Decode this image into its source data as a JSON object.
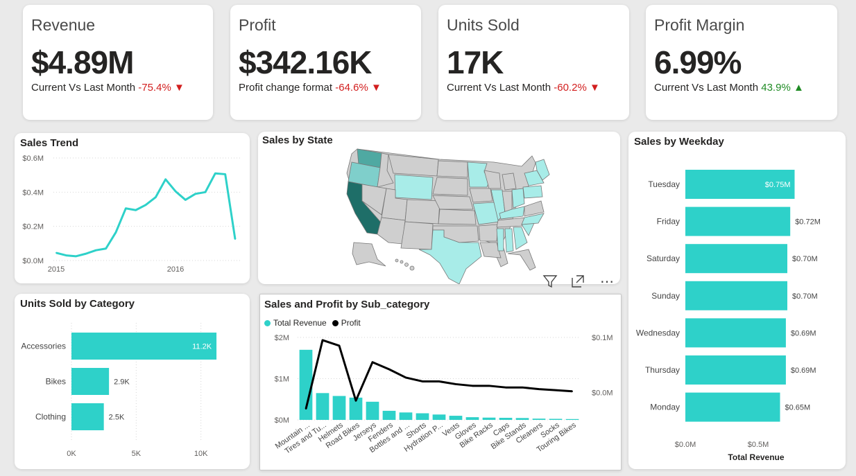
{
  "kpis": [
    {
      "title": "Revenue",
      "value": "$4.89M",
      "sub_label": "Current Vs Last Month",
      "change": "-75.4%",
      "direction": "down"
    },
    {
      "title": "Profit",
      "value": "$342.16K",
      "sub_label": "Profit change format",
      "change": "-64.6%",
      "direction": "down"
    },
    {
      "title": "Units Sold",
      "value": "17K",
      "sub_label": "Current Vs Last Month",
      "change": "-60.2%",
      "direction": "down"
    },
    {
      "title": "Profit Margin",
      "value": "6.99%",
      "sub_label": "Current Vs Last Month",
      "change": "43.9%",
      "direction": "up"
    }
  ],
  "arrows": {
    "down": "▼",
    "up": "▲"
  },
  "colors": {
    "teal": "#2ed1c9",
    "negative": "#d21e1e",
    "positive": "#1f8b24",
    "line": "#000000"
  },
  "toolbar_icons": [
    "filter-icon",
    "focus-mode-icon",
    "more-options-icon"
  ],
  "toolbar_glyphs": {
    "more": "⋯"
  },
  "chart_data": [
    {
      "id": "sales-trend",
      "type": "line",
      "title": "Sales Trend",
      "x_ticks": [
        "2015",
        "2016"
      ],
      "y_ticks": [
        "$0.0M",
        "$0.2M",
        "$0.4M",
        "$0.6M"
      ],
      "ylim": [
        0,
        0.6
      ],
      "values": [
        0.045,
        0.03,
        0.025,
        0.04,
        0.06,
        0.07,
        0.165,
        0.305,
        0.295,
        0.325,
        0.37,
        0.475,
        0.405,
        0.355,
        0.39,
        0.4,
        0.51,
        0.505,
        0.125
      ],
      "grid": true
    },
    {
      "id": "sales-by-state",
      "type": "map",
      "title": "Sales by State",
      "highlighted_regions": [
        "WA",
        "OR",
        "CA",
        "WY",
        "MN",
        "IL",
        "OH",
        "NY",
        "VT",
        "NH",
        "MA",
        "CT",
        "NC",
        "SC",
        "GA",
        "AL",
        "TX",
        "MO",
        "KY",
        "AZ"
      ]
    },
    {
      "id": "sales-by-weekday",
      "type": "bar",
      "orientation": "horizontal",
      "title": "Sales by Weekday",
      "categories": [
        "Tuesday",
        "Friday",
        "Saturday",
        "Sunday",
        "Wednesday",
        "Thursday",
        "Monday"
      ],
      "values": [
        0.75,
        0.72,
        0.7,
        0.7,
        0.69,
        0.69,
        0.65
      ],
      "labels": [
        "$0.75M",
        "$0.72M",
        "$0.70M",
        "$0.70M",
        "$0.69M",
        "$0.69M",
        "$0.65M"
      ],
      "x_ticks": [
        "$0.0M",
        "$0.5M"
      ],
      "xlabel": "Total Revenue",
      "xlim": [
        0,
        1.0
      ]
    },
    {
      "id": "units-by-category",
      "type": "bar",
      "orientation": "horizontal",
      "title": "Units Sold by Category",
      "categories": [
        "Accessories",
        "Bikes",
        "Clothing"
      ],
      "values": [
        11.2,
        2.9,
        2.5
      ],
      "labels": [
        "11.2K",
        "2.9K",
        "2.5K"
      ],
      "x_ticks": [
        "0K",
        "5K",
        "10K"
      ],
      "xlim": [
        0,
        12
      ]
    },
    {
      "id": "sales-profit-subcategory",
      "type": "bar",
      "title": "Sales and Profit by Sub_category",
      "legend": [
        "Total Revenue",
        "Profit"
      ],
      "categories": [
        "Mountain ...",
        "Tires and Tu...",
        "Helmets",
        "Road Bikes",
        "Jerseys",
        "Fenders",
        "Bottles and ...",
        "Shorts",
        "Hydration P...",
        "Vests",
        "Gloves",
        "Bike Racks",
        "Caps",
        "Bike Stands",
        "Cleaners",
        "Socks",
        "Touring Bikes"
      ],
      "series": [
        {
          "name": "Total Revenue",
          "axis": "left",
          "values": [
            1.7,
            0.65,
            0.58,
            0.54,
            0.44,
            0.22,
            0.18,
            0.16,
            0.13,
            0.1,
            0.065,
            0.055,
            0.05,
            0.045,
            0.03,
            0.025,
            0.02
          ]
        },
        {
          "name": "Profit",
          "axis": "right",
          "values": [
            -0.03,
            0.095,
            0.085,
            -0.015,
            0.055,
            0.042,
            0.027,
            0.02,
            0.02,
            0.015,
            0.012,
            0.012,
            0.009,
            0.009,
            0.006,
            0.004,
            0.002
          ]
        }
      ],
      "y_ticks_left": [
        "$0M",
        "$1M",
        "$2M"
      ],
      "y_ticks_right": [
        "$0.0M",
        "$0.1M"
      ],
      "ylim_left": [
        0,
        2
      ],
      "ylim_right": [
        -0.05,
        0.1
      ]
    }
  ]
}
